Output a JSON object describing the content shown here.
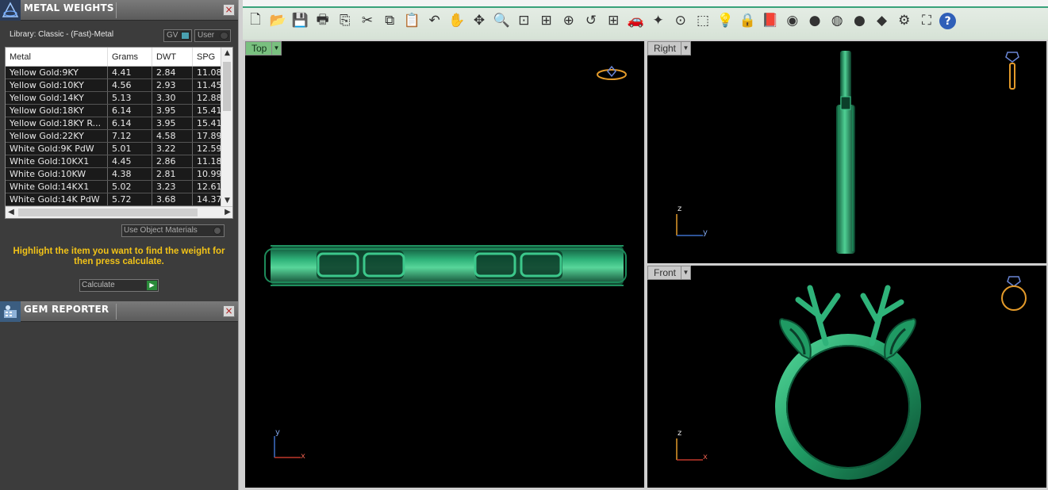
{
  "metal_panel": {
    "title": "METAL WEIGHTS",
    "close": "×",
    "library_label": "Library: Classic - (Fast)-Metal",
    "toggle_gv": "GV",
    "toggle_user": "User",
    "columns": [
      "Metal",
      "Grams",
      "DWT",
      "SPG"
    ],
    "rows": [
      [
        "Yellow Gold:9KY",
        "4.41",
        "2.84",
        "11.08"
      ],
      [
        "Yellow Gold:10KY",
        "4.56",
        "2.93",
        "11.45"
      ],
      [
        "Yellow Gold:14KY",
        "5.13",
        "3.30",
        "12.88"
      ],
      [
        "Yellow Gold:18KY",
        "6.14",
        "3.95",
        "15.41"
      ],
      [
        "Yellow Gold:18KY R...",
        "6.14",
        "3.95",
        "15.41"
      ],
      [
        "Yellow Gold:22KY",
        "7.12",
        "4.58",
        "17.89"
      ],
      [
        "White Gold:9K PdW",
        "5.01",
        "3.22",
        "12.59"
      ],
      [
        "White Gold:10KX1",
        "4.45",
        "2.86",
        "11.18"
      ],
      [
        "White Gold:10KW",
        "4.38",
        "2.81",
        "10.99"
      ],
      [
        "White Gold:14KX1",
        "5.02",
        "3.23",
        "12.61"
      ],
      [
        "White Gold:14K PdW",
        "5.72",
        "3.68",
        "14.37"
      ]
    ],
    "use_object_materials": "Use Object Materials",
    "hint": "Highlight the item you want to find the weight for then press calculate.",
    "calculate": "Calculate"
  },
  "gem_panel": {
    "title": "GEM REPORTER",
    "close": "×"
  },
  "toolbar": {
    "icons": [
      "new-icon",
      "open-icon",
      "save-icon",
      "print-icon",
      "export-icon",
      "cut-icon",
      "copy-icon",
      "paste-icon",
      "undo-icon",
      "pan-hand-icon",
      "rotate-view-icon",
      "zoom-icon",
      "zoom-window-icon",
      "zoom-extents-icon",
      "zoom-selected-icon",
      "undo-view-icon",
      "four-viewports-icon",
      "car-icon",
      "object-snap-icon",
      "osnap-circle-icon",
      "layers-icon",
      "lightbulb-icon",
      "lock-icon",
      "material-book-icon",
      "color-wheel-icon",
      "shade-sphere-icon",
      "render-sphere-icon",
      "blue-sphere-icon",
      "light-cone-icon",
      "settings-gear-icon",
      "group-icon",
      "help-icon"
    ],
    "glyphs": [
      "🗋",
      "📂",
      "💾",
      "🖶",
      "⎘",
      "✂",
      "⧉",
      "📋",
      "↶",
      "✋",
      "✥",
      "🔍",
      "⊡",
      "⊞",
      "⊕",
      "↺",
      "⊞",
      "🚗",
      "✦",
      "⊙",
      "⬚",
      "💡",
      "🔒",
      "📕",
      "◉",
      "●",
      "◍",
      "●",
      "◆",
      "⚙",
      "⛶",
      "?"
    ]
  },
  "viewports": {
    "top": {
      "label": "Top",
      "axis_a": "x",
      "axis_b": "y"
    },
    "right": {
      "label": "Right",
      "axis_a": "y",
      "axis_b": "z"
    },
    "front": {
      "label": "Front",
      "axis_a": "x",
      "axis_b": "z"
    }
  }
}
